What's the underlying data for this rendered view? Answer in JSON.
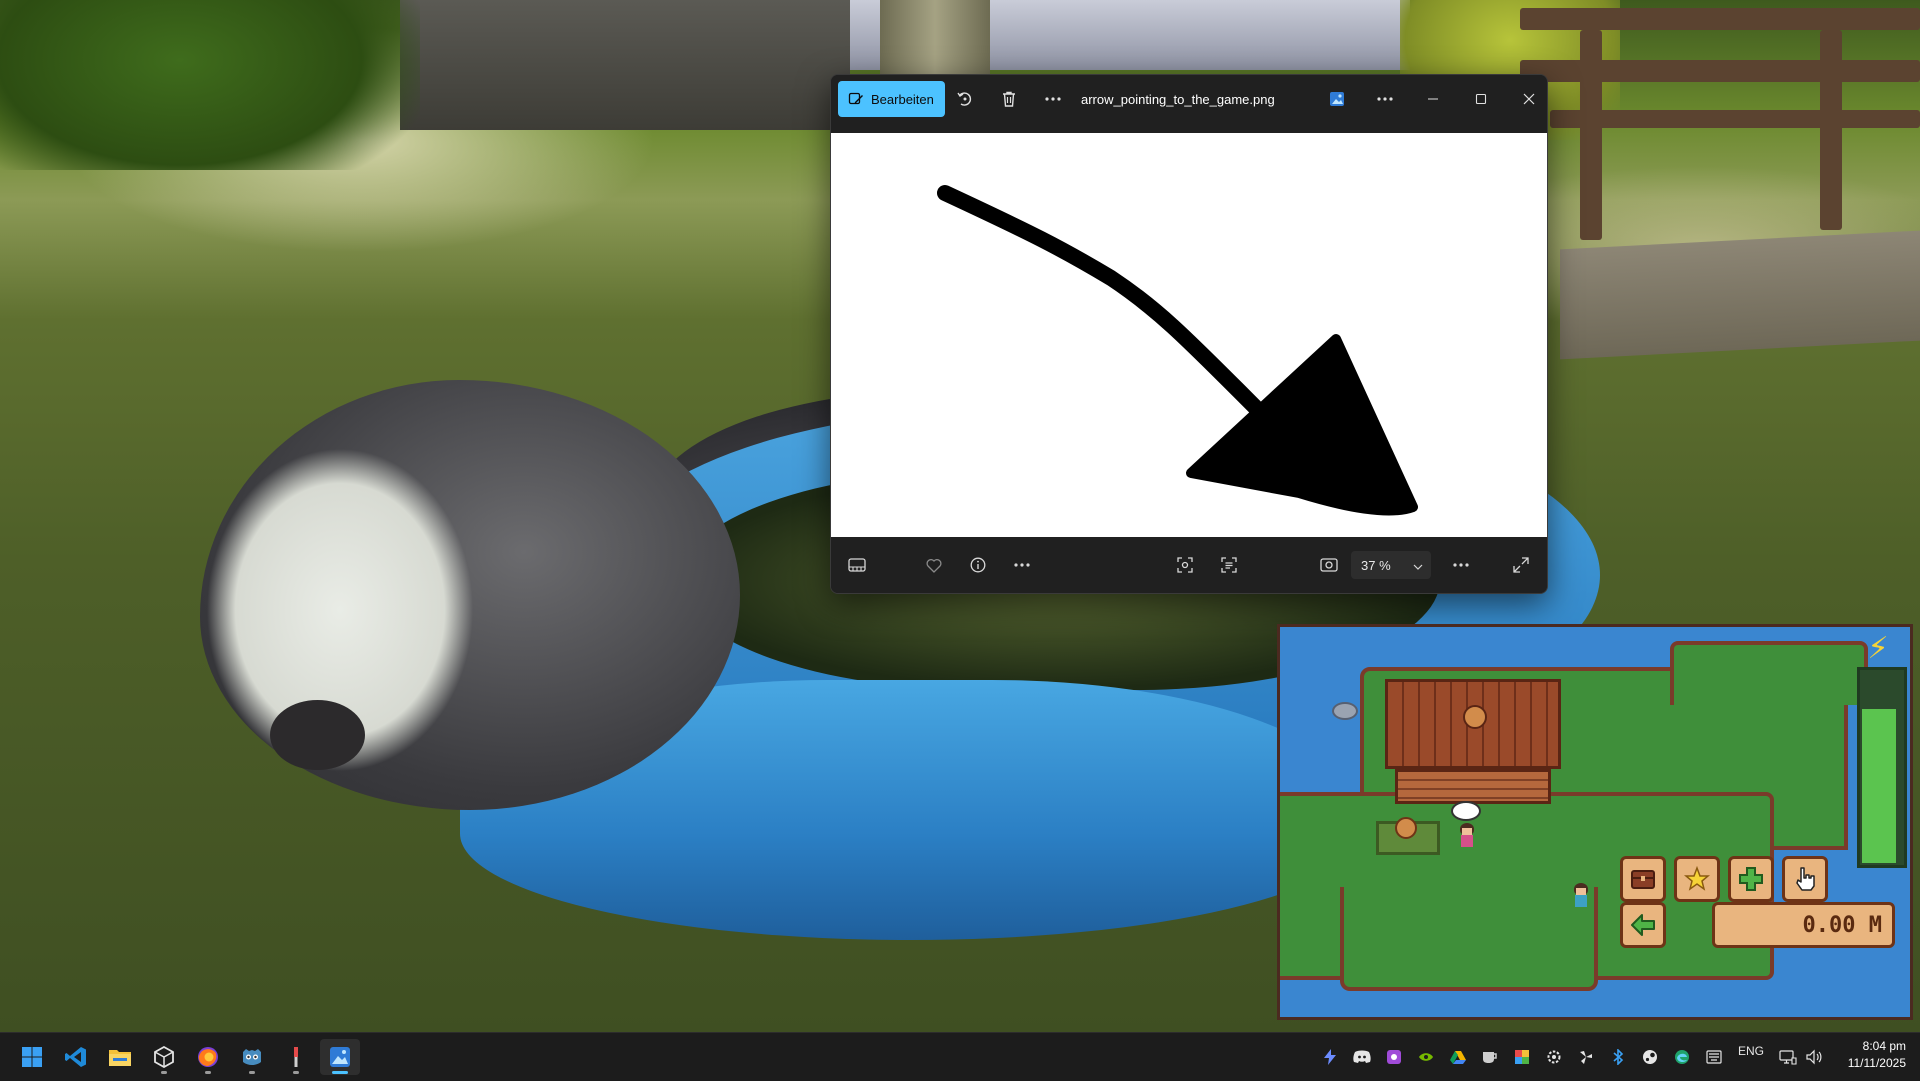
{
  "viewer": {
    "edit_label": "Bearbeiten",
    "filename": "arrow_pointing_to_the_game.png",
    "zoom_value": "37 %"
  },
  "game": {
    "distance": "0.00 M",
    "energy_fraction": 0.83
  },
  "taskbar": {
    "apps": [
      "windows-start-icon",
      "vscode-icon",
      "file-explorer-icon",
      "unity-icon",
      "firefox-icon",
      "godot-icon",
      "tool-icon",
      "photos-icon"
    ],
    "tray_icons": [
      "bolt-icon",
      "discord-icon",
      "app-icon",
      "nvidia-icon",
      "google-drive-icon",
      "mug-icon",
      "color-app-icon",
      "gear-app-icon",
      "fan-icon",
      "bluetooth-icon",
      "steam-icon",
      "edge-icon",
      "keyboard-icon"
    ],
    "language": "ENG",
    "time": "8:04 pm",
    "date": "11/11/2025"
  }
}
